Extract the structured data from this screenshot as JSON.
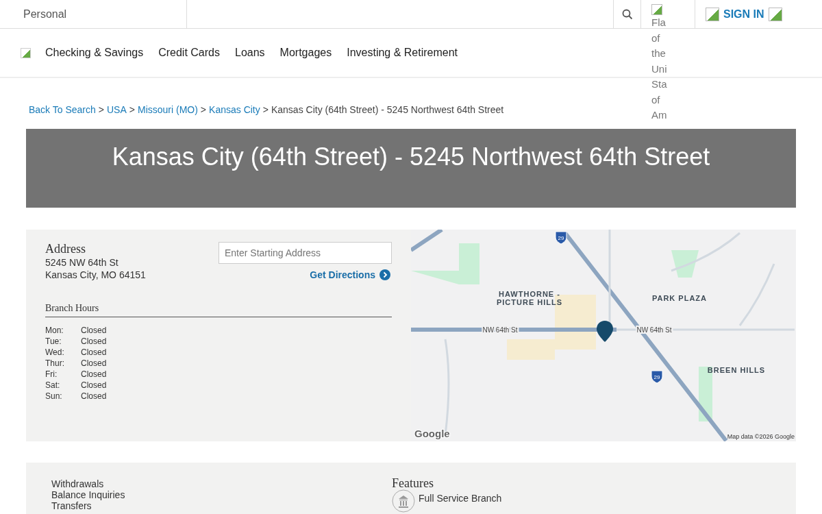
{
  "top_bar": {
    "segment": "Personal",
    "sign_in": "SIGN IN",
    "flag_alt": "Fla of the Uni Sta of Am"
  },
  "nav": {
    "items": [
      "Checking & Savings",
      "Credit Cards",
      "Loans",
      "Mortgages",
      "Investing & Retirement"
    ]
  },
  "breadcrumb": {
    "links": [
      "Back To Search",
      "USA",
      "Missouri (MO)",
      "Kansas City"
    ],
    "separator": ">",
    "current": "Kansas City (64th Street) - 5245 Northwest 64th Street"
  },
  "banner": {
    "title": "Kansas City (64th Street) - 5245 Northwest 64th Street"
  },
  "address": {
    "heading": "Address",
    "line1": "5245 NW 64th St",
    "line2": "Kansas City, MO 64151"
  },
  "directions": {
    "placeholder": "Enter Starting Address",
    "button": "Get Directions"
  },
  "hours": {
    "heading": "Branch Hours",
    "rows": [
      {
        "day": "Mon:",
        "hours": "Closed"
      },
      {
        "day": "Tue:",
        "hours": "Closed"
      },
      {
        "day": "Wed:",
        "hours": "Closed"
      },
      {
        "day": "Thur:",
        "hours": "Closed"
      },
      {
        "day": "Fri:",
        "hours": "Closed"
      },
      {
        "day": "Sat:",
        "hours": "Closed"
      },
      {
        "day": "Sun:",
        "hours": "Closed"
      }
    ]
  },
  "map": {
    "labels": [
      {
        "text": "HAWTHORNE -",
        "kind": "area"
      },
      {
        "text": "PICTURE HILLS",
        "kind": "area"
      },
      {
        "text": "PARK PLAZA",
        "kind": "area"
      },
      {
        "text": "BREEN HILLS",
        "kind": "area"
      },
      {
        "text": "NW 64th St",
        "kind": "street"
      },
      {
        "text": "NW 64th St",
        "kind": "street"
      },
      {
        "text": "29",
        "kind": "shield"
      },
      {
        "text": "29",
        "kind": "shield"
      }
    ],
    "google": "Google",
    "attribution": "Map data ©2026 Google"
  },
  "services": {
    "items": [
      "Withdrawals",
      "Balance Inquiries",
      "Transfers"
    ]
  },
  "features": {
    "heading": "Features",
    "items": [
      "Full Service Branch"
    ]
  }
}
